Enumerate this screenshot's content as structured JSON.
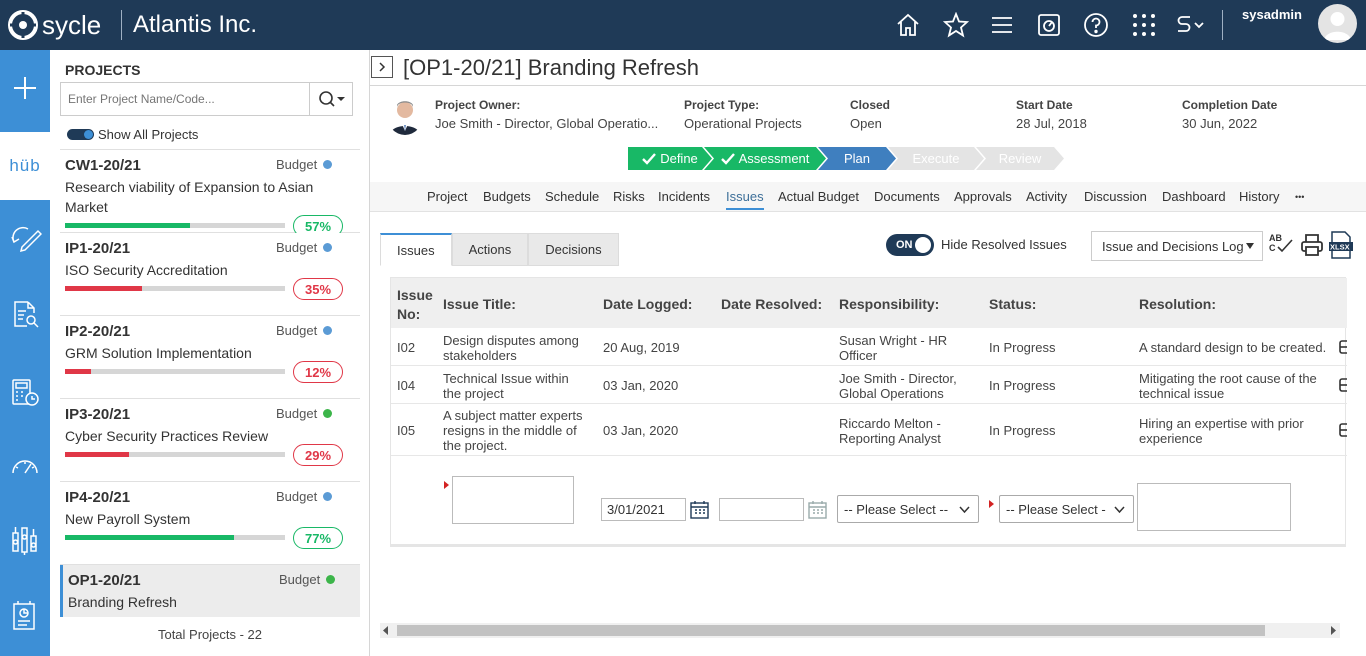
{
  "app": {
    "logo_text": "sycle",
    "company": "Atlantis Inc.",
    "user": "sysadmin"
  },
  "rail": {
    "hub_label": "hüb"
  },
  "projects": {
    "title": "PROJECTS",
    "search_placeholder": "Enter Project Name/Code...",
    "show_all_label": "Show All Projects",
    "items": [
      {
        "code": "CW1-20/21",
        "budget": "Budget",
        "dot": "#5b9bd5",
        "name": "Research viability of Expansion to Asian Market",
        "pct": "57%",
        "pct_value": 0.57,
        "color": "#18b866"
      },
      {
        "code": "IP1-20/21",
        "budget": "Budget",
        "dot": "#5b9bd5",
        "name": "ISO Security Accreditation",
        "pct": "35%",
        "pct_value": 0.35,
        "color": "#e03747"
      },
      {
        "code": "IP2-20/21",
        "budget": "Budget",
        "dot": "#5b9bd5",
        "name": "GRM Solution Implementation",
        "pct": "12%",
        "pct_value": 0.12,
        "color": "#e03747"
      },
      {
        "code": "IP3-20/21",
        "budget": "Budget",
        "dot": "#3cb54a",
        "name": "Cyber Security Practices Review",
        "pct": "29%",
        "pct_value": 0.29,
        "color": "#e03747"
      },
      {
        "code": "IP4-20/21",
        "budget": "Budget",
        "dot": "#5b9bd5",
        "name": "New Payroll System",
        "pct": "77%",
        "pct_value": 0.77,
        "color": "#18b866"
      },
      {
        "code": "OP1-20/21",
        "budget": "Budget",
        "dot": "#3cb54a",
        "name": "Branding Refresh"
      }
    ],
    "total": "Total Projects - 22"
  },
  "project": {
    "title": "[OP1-20/21] Branding Refresh",
    "owner_label": "Project Owner:",
    "owner_value": "Joe Smith - Director, Global Operatio...",
    "type_label": "Project Type:",
    "type_value": "Operational Projects",
    "closed_label": "Closed",
    "closed_value": "Open",
    "start_label": "Start Date",
    "start_value": "28 Jul, 2018",
    "completion_label": "Completion Date",
    "completion_value": "30 Jun, 2022"
  },
  "stages": [
    {
      "label": "Define",
      "color": "#18b866",
      "check": true
    },
    {
      "label": "Assessment",
      "color": "#18b866",
      "check": true
    },
    {
      "label": "Plan",
      "color": "#3f7fbf",
      "check": false
    },
    {
      "label": "Execute",
      "color": "#e4e4e4",
      "check": false
    },
    {
      "label": "Review",
      "color": "#e4e4e4",
      "check": false
    }
  ],
  "tabs": [
    "Project",
    "Budgets",
    "Schedule",
    "Risks",
    "Incidents",
    "Issues",
    "Actual Budget",
    "Documents",
    "Approvals",
    "Activity",
    "Discussion",
    "Dashboard",
    "History",
    "•••"
  ],
  "subtabs": [
    "Issues",
    "Actions",
    "Decisions"
  ],
  "controls": {
    "toggle_on": "ON",
    "hide_resolved": "Hide Resolved Issues",
    "log_select": "Issue and Decisions Log"
  },
  "table": {
    "headers": {
      "no": "Issue No:",
      "title": "Issue Title:",
      "logged": "Date Logged:",
      "resolved": "Date Resolved:",
      "resp": "Responsibility:",
      "status": "Status:",
      "resolution": "Resolution:"
    },
    "rows": [
      {
        "no": "I02",
        "title": "Design disputes among stakeholders",
        "logged": "20 Aug, 2019",
        "resolved": "",
        "resp": "Susan Wright - HR Officer",
        "status": "In Progress",
        "resolution": "A standard design to be created."
      },
      {
        "no": "I04",
        "title": "Technical Issue within the project",
        "logged": "03 Jan, 2020",
        "resolved": "",
        "resp": "Joe Smith - Director, Global Operations",
        "status": "In Progress",
        "resolution": "Mitigating the root cause of the technical issue"
      },
      {
        "no": "I05",
        "title": "A subject matter experts resigns in the middle of the project.",
        "logged": "03 Jan, 2020",
        "resolved": "",
        "resp": "Riccardo Melton - Reporting Analyst",
        "status": "In Progress",
        "resolution": "Hiring an expertise with prior experience"
      }
    ],
    "new_row": {
      "date_logged": "3/01/2021",
      "resp_placeholder": "-- Please Select --",
      "status_placeholder": "-- Please Select -"
    }
  }
}
